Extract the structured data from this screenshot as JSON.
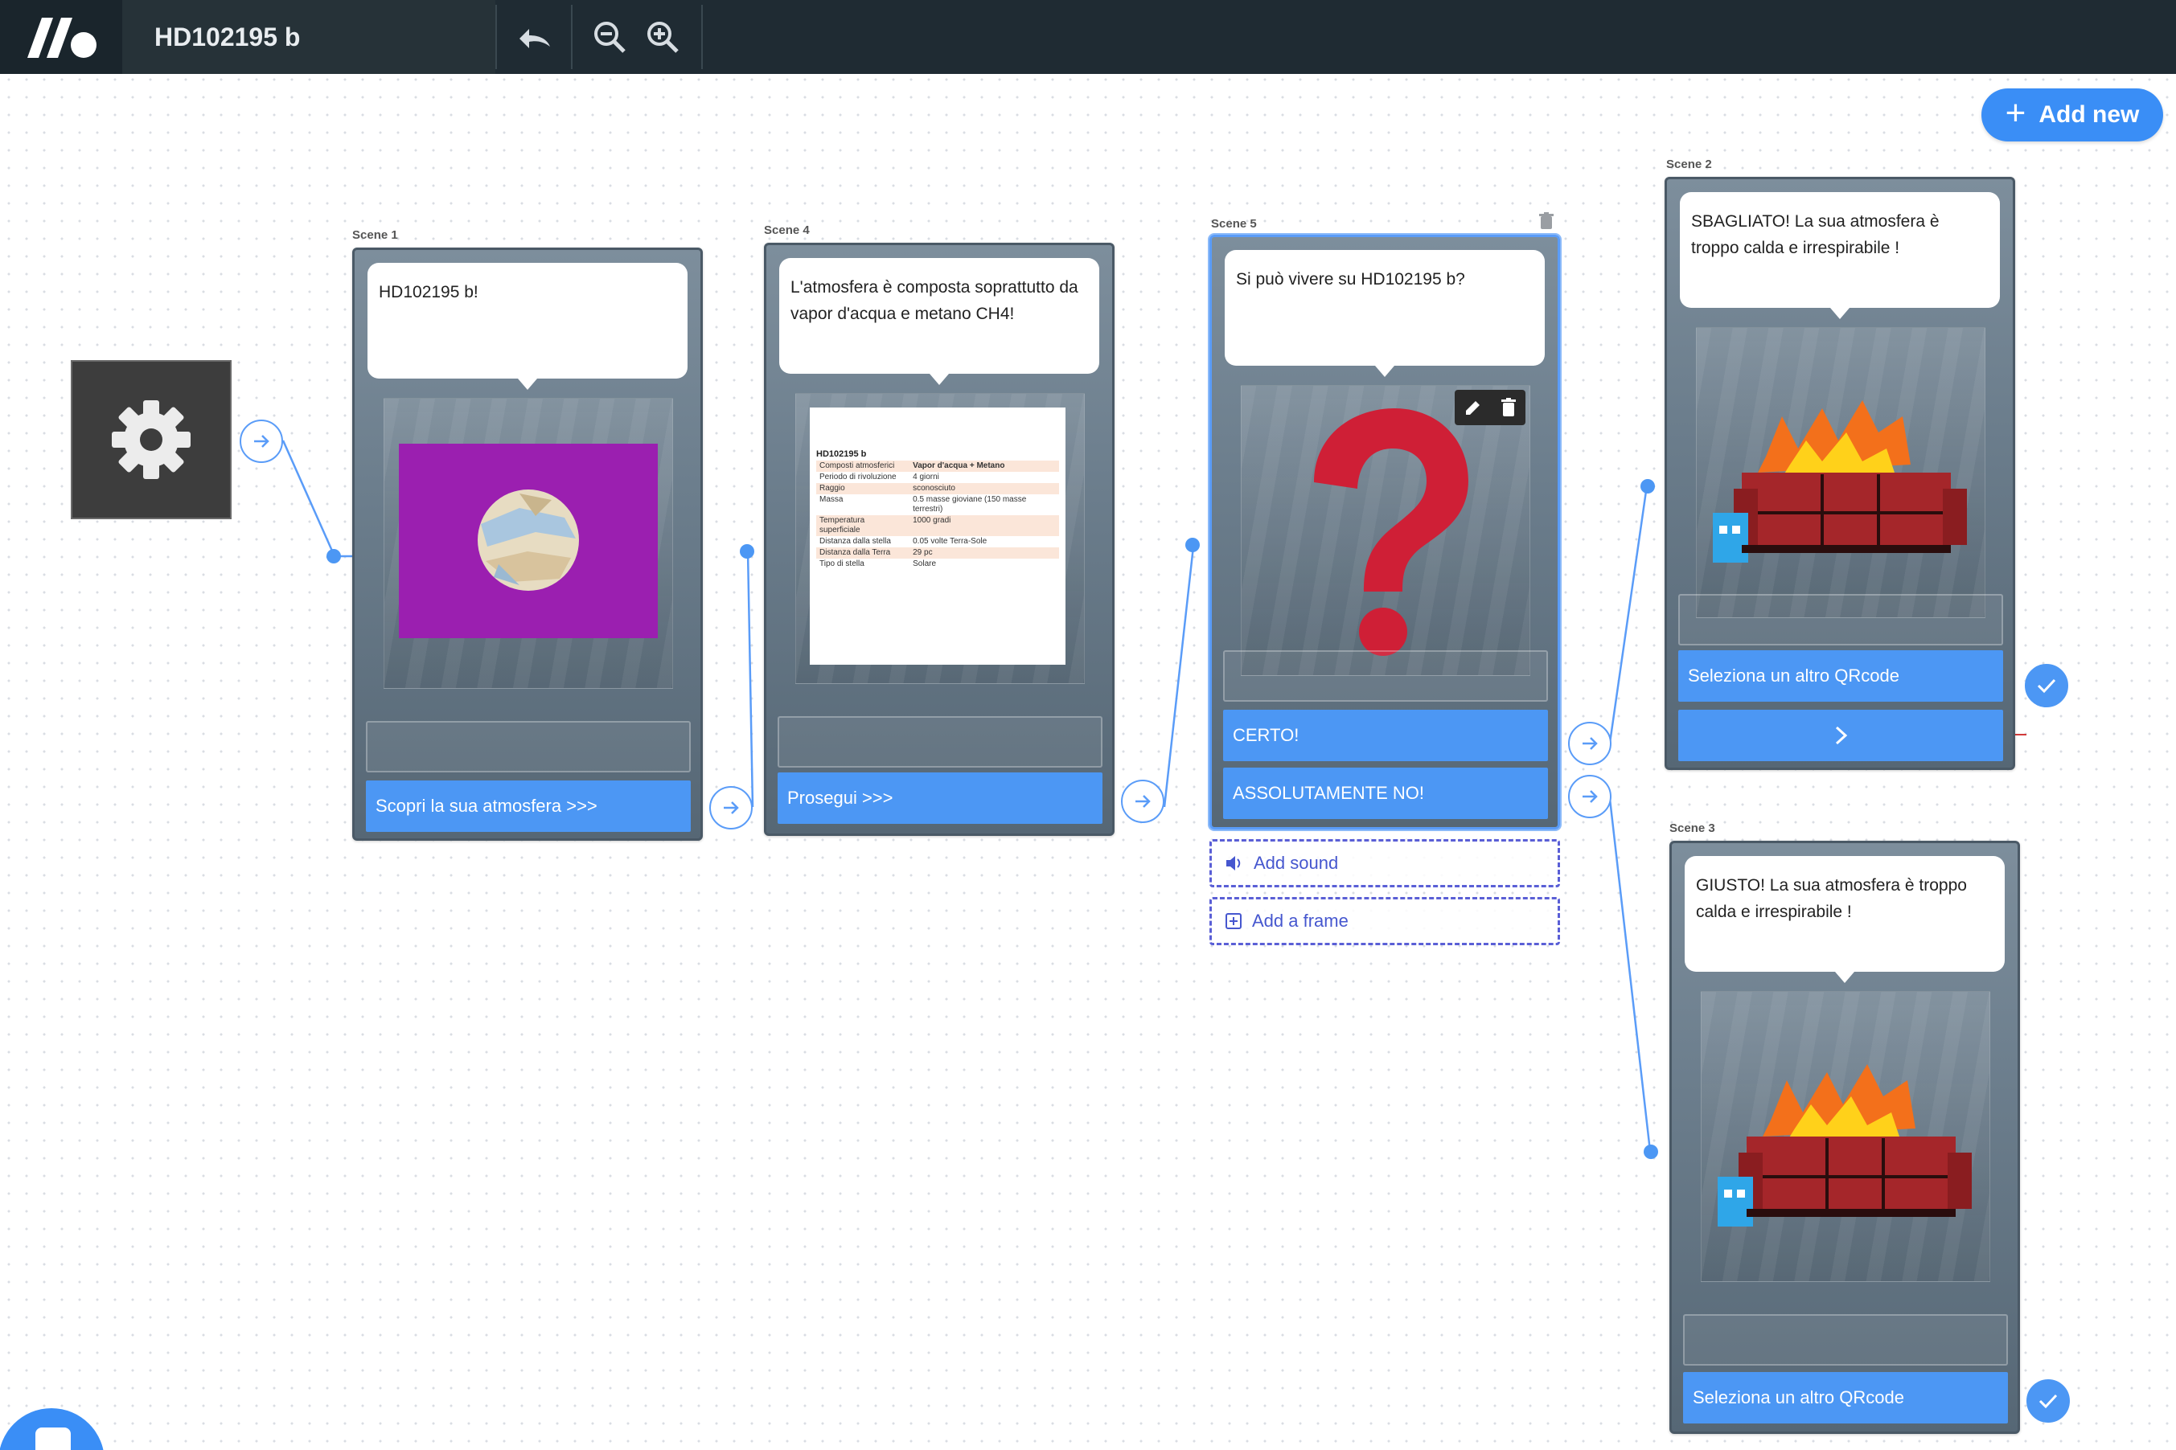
{
  "app": {
    "title": "HD102195 b"
  },
  "toolbar": {
    "undo": "undo-icon",
    "zoom_out": "zoom-out-icon",
    "zoom_in": "zoom-in-icon"
  },
  "add_new": {
    "label": "Add new"
  },
  "scenes": {
    "s1": {
      "label": "Scene 1",
      "text": "HD102195 b!",
      "button": "Scopri la sua atmosfera >>>"
    },
    "s4": {
      "label": "Scene 4",
      "text": "L'atmosfera è composta soprattutto da vapor d'acqua e metano CH4!",
      "button": "Prosegui >>>",
      "table": {
        "title": "HD102195 b",
        "rows": [
          {
            "k": "Composti atmosferici",
            "v": "Vapor d'acqua + Metano"
          },
          {
            "k": "Periodo di rivoluzione",
            "v": "4 giorni"
          },
          {
            "k": "Raggio",
            "v": "sconosciuto"
          },
          {
            "k": "Massa",
            "v": "0.5 masse gioviane (150 masse terrestri)"
          },
          {
            "k": "Temperatura superficiale",
            "v": "1000 gradi"
          },
          {
            "k": "Distanza dalla stella",
            "v": "0.05 volte Terra-Sole"
          },
          {
            "k": "Distanza dalla Terra",
            "v": "29 pc"
          },
          {
            "k": "Tipo di stella",
            "v": "Solare"
          }
        ]
      }
    },
    "s5": {
      "label": "Scene 5",
      "text": "Si può vivere su HD102195 b?",
      "choice1": "CERTO!",
      "choice2": "ASSOLUTAMENTE NO!",
      "add_sound": "Add sound",
      "add_frame": "Add a frame"
    },
    "s2": {
      "label": "Scene 2",
      "text": "SBAGLIATO! La sua atmosfera è troppo calda e irrespirabile !",
      "button": "Seleziona un altro QRcode",
      "next": "chevron-right-icon"
    },
    "s3": {
      "label": "Scene 3",
      "text": "GIUSTO! La sua atmosfera è troppo calda e irrespirabile !",
      "button": "Seleziona un altro QRcode"
    }
  },
  "colors": {
    "accent": "#4c97f4",
    "topbar": "#1f2b33",
    "scene": "#6c7e8d"
  }
}
